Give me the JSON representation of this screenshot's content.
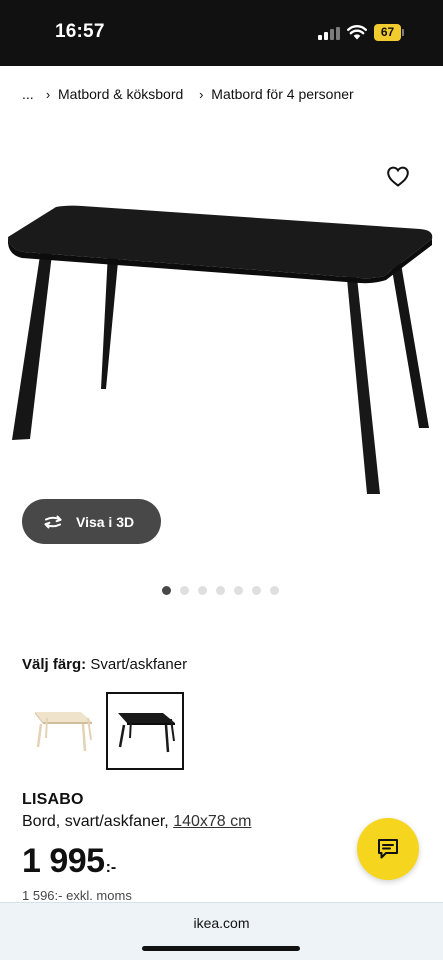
{
  "status_bar": {
    "time": "16:57",
    "battery_level": "67",
    "icons": [
      "signal-icon",
      "wifi-icon",
      "battery-icon"
    ],
    "battery_color": "#f2cc2f"
  },
  "breadcrumb": {
    "ellipsis": "...",
    "items": [
      "Matbord & köksbord",
      "Matbord för 4 personer"
    ]
  },
  "gallery": {
    "favourite_icon": "heart-outline-icon",
    "view_3d_label": "Visa i 3D",
    "view_3d_icon": "rotate-arrows-icon",
    "image_count": 7,
    "active_index": 0
  },
  "color_picker": {
    "label": "Välj färg:",
    "selected_value": "Svart/askfaner",
    "options": [
      {
        "name": "light-ash-table-swatch",
        "color": "#e9dcc4",
        "selected": false
      },
      {
        "name": "black-table-swatch",
        "color": "#1a1a1a",
        "selected": true
      }
    ]
  },
  "product": {
    "name": "LISABO",
    "description": "Bord, svart/askfaner, ",
    "dimensions": "140x78 cm",
    "price": "1 995",
    "price_suffix": ":-",
    "price_excl_vat": "1 596:- exkl. moms"
  },
  "chat": {
    "icon": "chat-bubble-icon",
    "color": "#f6d51f"
  },
  "browser": {
    "url": "ikea.com"
  }
}
